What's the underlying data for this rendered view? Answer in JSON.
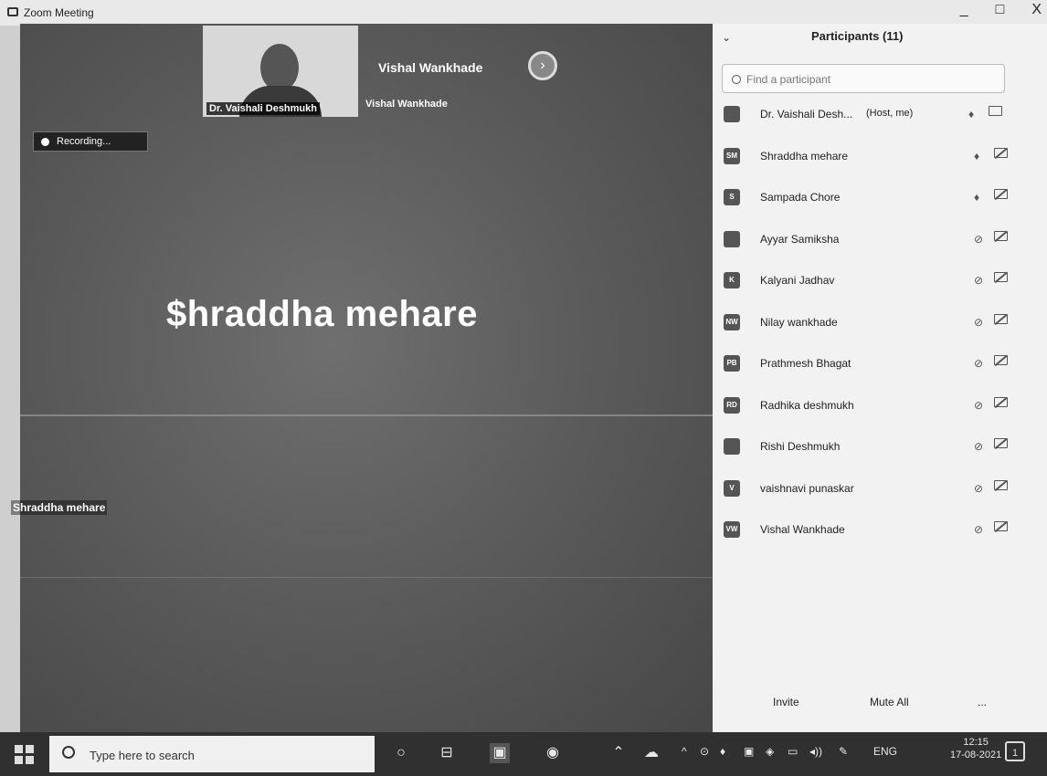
{
  "window": {
    "title": "Zoom Meeting",
    "controls": [
      "_",
      "□",
      "X"
    ]
  },
  "video": {
    "thumbnail_self_label": "Dr. Vaishali Deshmukh",
    "thumbnail_other_name": "Vishal Wankhade",
    "thumbnail_other_label": "Vishal Wankhade",
    "next_button": "›",
    "recording": "Recording...",
    "active_speaker": "$hraddha mehare",
    "name_tag": "Shraddha mehare"
  },
  "participants_panel": {
    "title": "Participants (11)",
    "search_placeholder": "Find a participant",
    "participants": [
      {
        "initials": "",
        "name": "Dr. Vaishali Desh...",
        "role": "(Host, me)",
        "muted": false,
        "video_off": false
      },
      {
        "initials": "SM",
        "name": "Shraddha mehare",
        "role": "",
        "muted": false,
        "video_off": true
      },
      {
        "initials": "S",
        "name": "Sampada Chore",
        "role": "",
        "muted": false,
        "video_off": true
      },
      {
        "initials": "",
        "name": "Ayyar Samiksha",
        "role": "",
        "muted": true,
        "video_off": true
      },
      {
        "initials": "K",
        "name": "Kalyani Jadhav",
        "role": "",
        "muted": true,
        "video_off": true
      },
      {
        "initials": "NW",
        "name": "Nilay wankhade",
        "role": "",
        "muted": true,
        "video_off": true
      },
      {
        "initials": "PB",
        "name": "Prathmesh Bhagat",
        "role": "",
        "muted": true,
        "video_off": true
      },
      {
        "initials": "RD",
        "name": "Radhika deshmukh",
        "role": "",
        "muted": true,
        "video_off": true
      },
      {
        "initials": "",
        "name": "Rishi Deshmukh",
        "role": "",
        "muted": true,
        "video_off": true
      },
      {
        "initials": "V",
        "name": "vaishnavi punaskar",
        "role": "",
        "muted": true,
        "video_off": true
      },
      {
        "initials": "VW",
        "name": "Vishal Wankhade",
        "role": "",
        "muted": true,
        "video_off": true
      }
    ],
    "footer": {
      "invite": "Invite",
      "mute_all": "Mute All",
      "more": "..."
    }
  },
  "taskbar": {
    "search_placeholder": "Type here to search",
    "language": "ENG",
    "time": "12:15",
    "date": "17-08-2021",
    "notifications": "1"
  }
}
